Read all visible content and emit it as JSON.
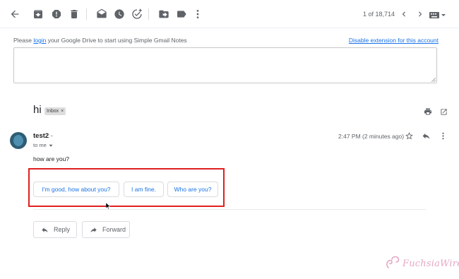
{
  "toolbar": {
    "icons": [
      "back-arrow-icon",
      "archive-icon",
      "report-spam-icon",
      "delete-icon",
      "mark-unread-icon",
      "snooze-icon",
      "add-task-icon",
      "move-to-icon",
      "label-icon",
      "more-vert-icon"
    ],
    "pagination": "1 of 18,714"
  },
  "notes": {
    "prefix": "Please ",
    "login_link": "login",
    "suffix": " your Google Drive to start using Simple Gmail Notes",
    "disable_link": "Disable extension for this account"
  },
  "email": {
    "subject": "hi",
    "label": "Inbox",
    "label_remove": "×",
    "sender_name": "test2",
    "sender_dash": " -",
    "recipient": "to me",
    "time": "2:47 PM (2 minutes ago)",
    "body": "how are you?"
  },
  "smart_replies": [
    "I'm good, how about you?",
    "I am fine.",
    "Who are you?"
  ],
  "actions": {
    "reply": "Reply",
    "forward": "Forward"
  },
  "watermark": {
    "text": "FuchsiaWire"
  },
  "colors": {
    "link": "#1a73e8",
    "highlight": "#e02020",
    "icon": "#5f6368",
    "watermark": "#e6a8c6"
  }
}
